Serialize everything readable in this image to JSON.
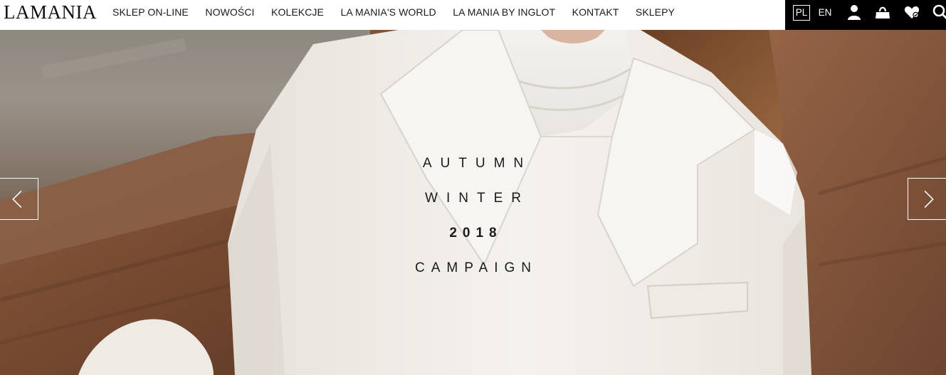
{
  "brand": {
    "logo_text": "LAMANIA"
  },
  "nav": {
    "items": [
      {
        "label": "SKLEP ON-LINE"
      },
      {
        "label": "NOWOŚCI"
      },
      {
        "label": "KOLEKCJE"
      },
      {
        "label": "LA MANIA'S WORLD"
      },
      {
        "label": "LA MANIA BY INGLOT"
      },
      {
        "label": "KONTAKT"
      },
      {
        "label": "SKLEPY"
      }
    ]
  },
  "utility": {
    "lang_pl": "PL",
    "lang_en": "EN",
    "active_language": "PL",
    "icons": [
      "user-icon",
      "shopping-bag-icon",
      "wishlist-heart-icon",
      "search-icon"
    ]
  },
  "hero": {
    "line1": "AUTUMN",
    "line2": "WINTER",
    "line3": "2018",
    "line4": "CAMPAIGN",
    "prev_icon": "chevron-left-icon",
    "next_icon": "chevron-right-icon"
  },
  "colors": {
    "header_bg": "#ffffff",
    "utility_bg": "#000000",
    "text_dark": "#1a1a1a",
    "blazer_white": "#f2efea",
    "floor_wood": "#7a4e35"
  }
}
